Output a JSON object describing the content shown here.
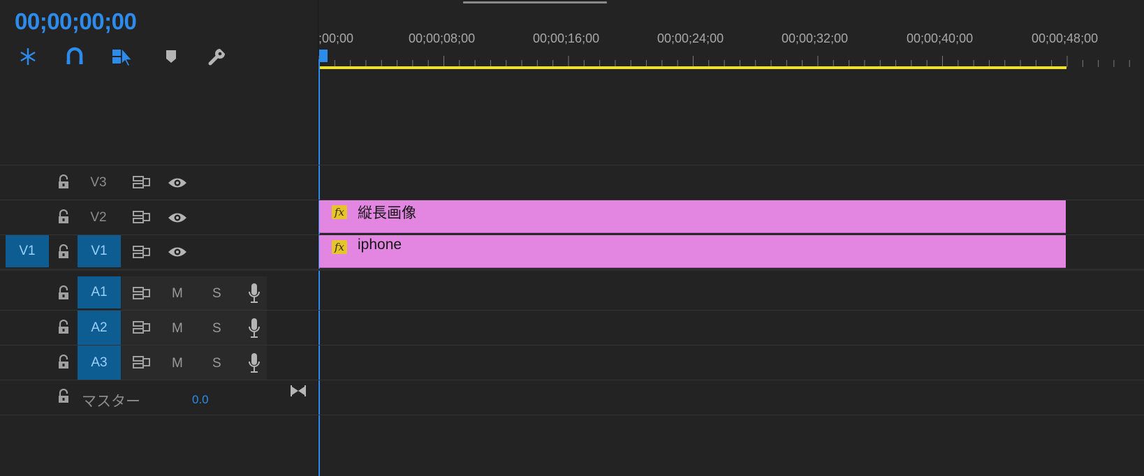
{
  "timecode": "00;00;00;00",
  "toolbar": {
    "tools": [
      "insert-nested-sequence-icon",
      "snap-magnet-icon",
      "linked-selection-icon",
      "add-marker-icon",
      "timeline-settings-wrench-icon"
    ]
  },
  "ruler": {
    "labels": [
      ";00;00",
      "00;00;08;00",
      "00;00;16;00",
      "00;00;24;00",
      "00;00;32;00",
      "00;00;40;00",
      "00;00;48;00"
    ]
  },
  "tracks": {
    "video": [
      {
        "name": "V3",
        "source_target": ""
      },
      {
        "name": "V2",
        "source_target": ""
      },
      {
        "name": "V1",
        "source_target": "V1"
      }
    ],
    "audio": [
      {
        "name": "A1",
        "mute": "M",
        "solo": "S"
      },
      {
        "name": "A2",
        "mute": "M",
        "solo": "S"
      },
      {
        "name": "A3",
        "mute": "M",
        "solo": "S"
      }
    ],
    "master": {
      "label": "マスター",
      "value": "0.0"
    }
  },
  "clips": [
    {
      "track": "V2",
      "fx": "fx",
      "name": "縦長画像"
    },
    {
      "track": "V1",
      "fx": "fx",
      "name": "iphone"
    }
  ],
  "colors": {
    "accent": "#2d8ceb",
    "clip": "#e386e2",
    "work_area": "#f2e318",
    "target_on": "#0d5d93",
    "fx_badge": "#e5c52a"
  }
}
